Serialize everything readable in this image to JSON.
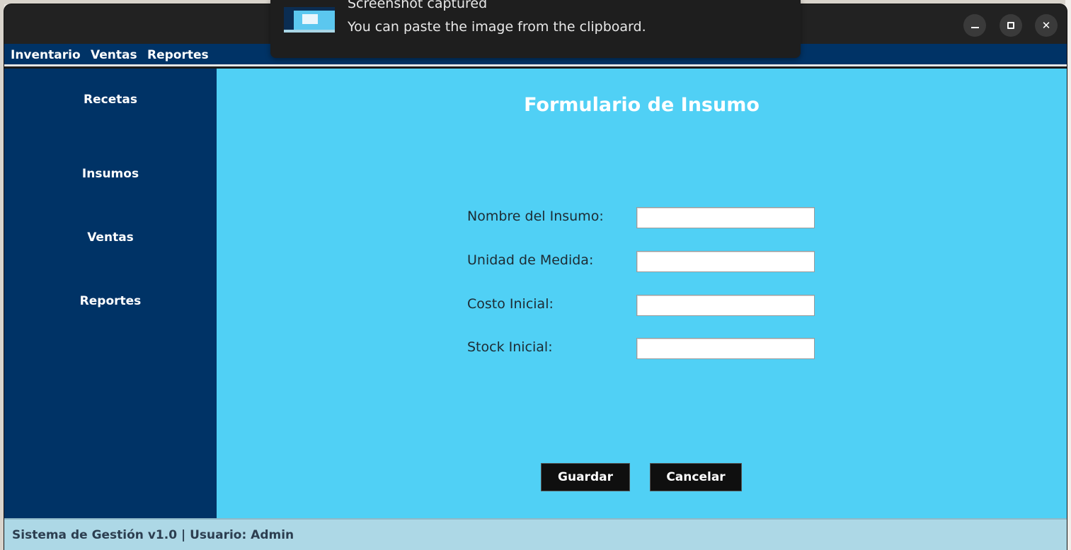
{
  "menubar": {
    "items": [
      "Inventario",
      "Ventas",
      "Reportes"
    ]
  },
  "sidebar": {
    "items": [
      "Recetas",
      "Insumos",
      "Ventas",
      "Reportes"
    ]
  },
  "form": {
    "title": "Formulario de Insumo",
    "fields": [
      {
        "label": "Nombre del Insumo:",
        "value": ""
      },
      {
        "label": "Unidad de Medida:",
        "value": ""
      },
      {
        "label": "Costo Inicial:",
        "value": ""
      },
      {
        "label": "Stock Inicial:",
        "value": ""
      }
    ],
    "save_label": "Guardar",
    "cancel_label": "Cancelar"
  },
  "statusbar": {
    "text": "Sistema de Gestión v1.0 | Usuario: Admin"
  },
  "notification": {
    "title": "Screenshot captured",
    "body": "You can paste the image from the clipboard."
  },
  "window_controls": {
    "minimize_icon": "minimize-icon",
    "maximize_icon": "maximize-icon",
    "close_icon": "close-icon"
  },
  "colors": {
    "navy": "#003366",
    "content_bg": "#50d0f5",
    "status_bg": "#add8e6",
    "button_bg": "#0f0f0f"
  }
}
